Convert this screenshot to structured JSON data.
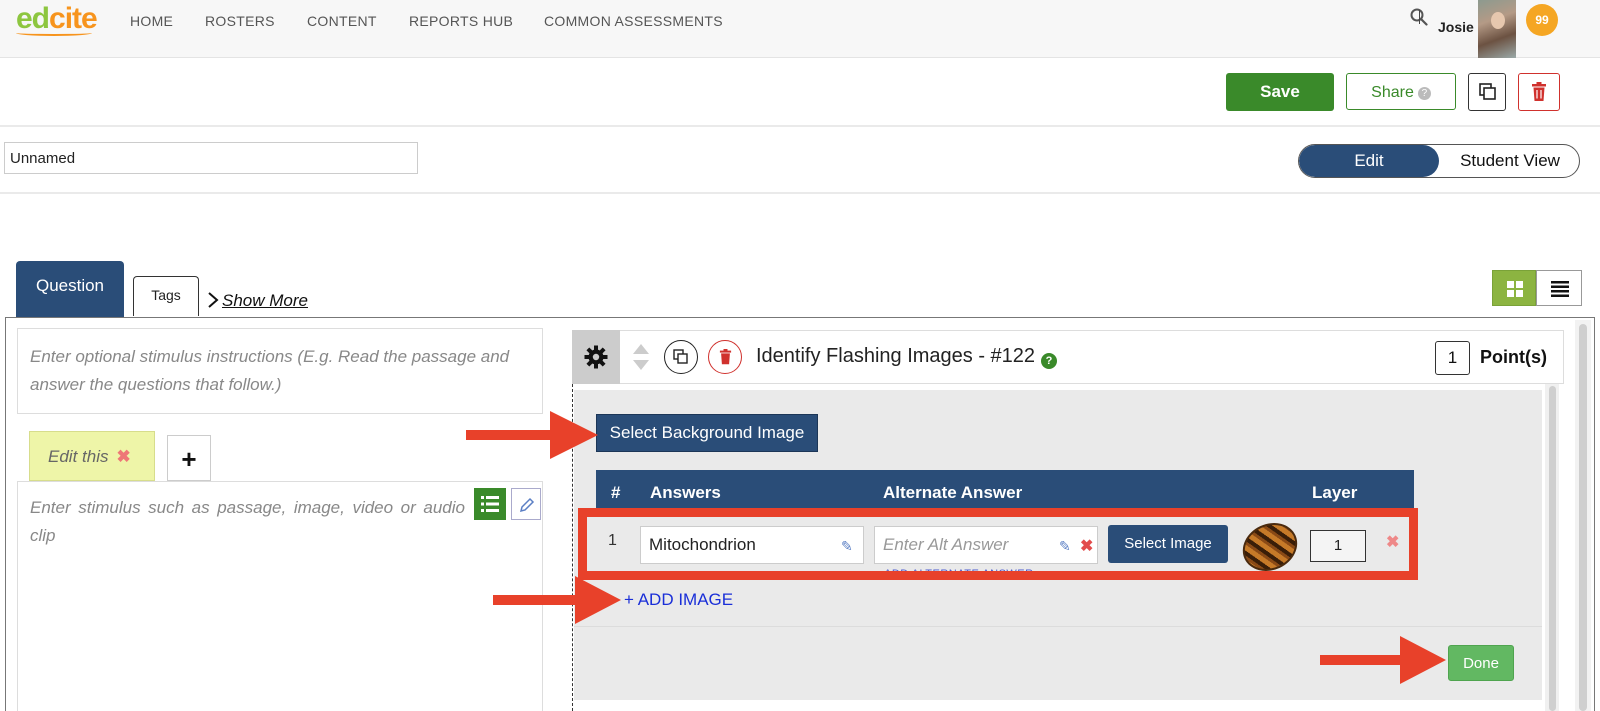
{
  "nav": {
    "logo": {
      "first": "ed",
      "rest": "cite"
    },
    "items": [
      "HOME",
      "ROSTERS",
      "CONTENT",
      "REPORTS HUB",
      "COMMON ASSESSMENTS"
    ],
    "user_name": "Josie",
    "badge": "99"
  },
  "toolbar": {
    "save_label": "Save",
    "share_label": "Share",
    "share_help": "?"
  },
  "assessment": {
    "name_value": "Unnamed"
  },
  "view_toggle": {
    "edit_label": "Edit",
    "student_label": "Student View"
  },
  "tabs": {
    "question": "Question",
    "tags": "Tags",
    "show_more": "Show More"
  },
  "stimulus": {
    "instructions_placeholder": "Enter optional stimulus instructions (E.g. Read the passage and answer the questions that follow.)",
    "tab_label": "Edit this",
    "add_tab": "+",
    "content_placeholder": "Enter stimulus such as passage, image, video or audio clip"
  },
  "question": {
    "title": "Identify Flashing Images - #122",
    "help": "?",
    "points_value": "1",
    "points_label": "Point(s)",
    "select_bg_label": "Select Background Image",
    "table_headers": {
      "num": "#",
      "answers": "Answers",
      "alternate": "Alternate Answer",
      "layer": "Layer"
    },
    "rows": [
      {
        "num": "1",
        "answer": "Mitochondrion",
        "alt_placeholder": "Enter Alt Answer",
        "select_image": "Select Image",
        "layer": "1",
        "add_alt": "ADD ALTERNATE ANSWER"
      }
    ],
    "add_image_label": "+ ADD IMAGE",
    "done_label": "Done"
  },
  "colors": {
    "brand_blue": "#2a4d78",
    "save_green": "#3a8a2a",
    "annotation_red": "#e8412a",
    "done_green": "#62b862"
  }
}
